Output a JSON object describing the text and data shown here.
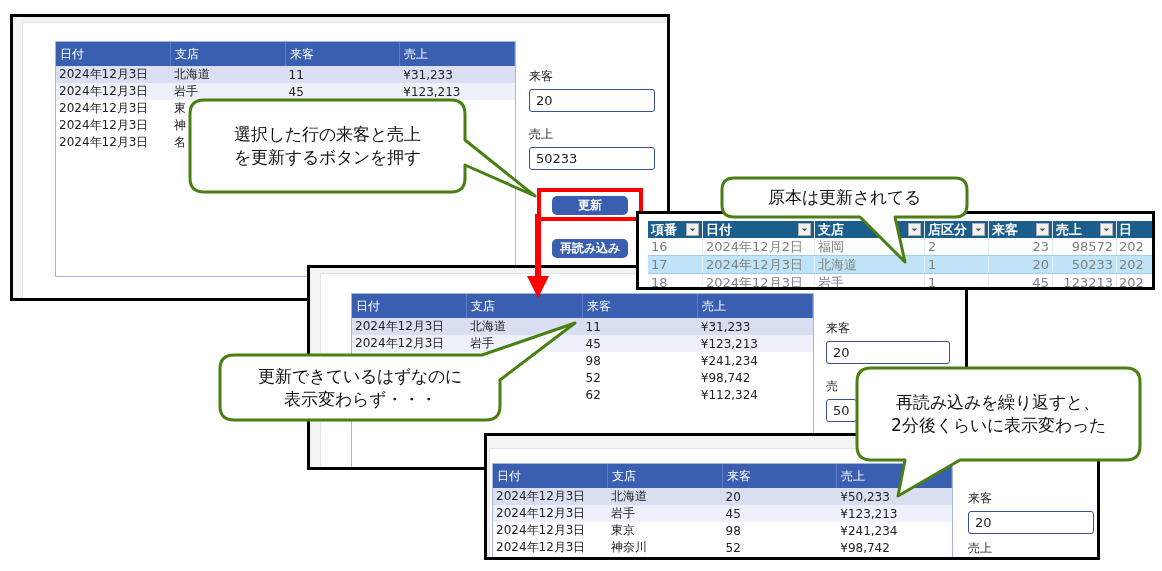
{
  "panels": [
    {
      "kind": "app",
      "columns": [
        "日付",
        "支店",
        "来客",
        "売上"
      ],
      "rows": [
        {
          "date": "2024年12月3日",
          "branch": "北海道",
          "visitors": "11",
          "sales": "¥31,233",
          "selected": true,
          "hover": false
        },
        {
          "date": "2024年12月3日",
          "branch": "岩手",
          "visitors": "45",
          "sales": "¥123,213",
          "selected": false,
          "hover": true
        },
        {
          "date": "2024年12月3日",
          "branch": "東",
          "selected": false,
          "hover": false
        },
        {
          "date": "2024年12月3日",
          "branch": "神",
          "selected": false,
          "hover": false
        },
        {
          "date": "2024年12月3日",
          "branch": "名",
          "selected": false,
          "hover": false
        }
      ],
      "fields": [
        {
          "label": "来客",
          "value": "20"
        },
        {
          "label": "売上",
          "value": "50233"
        }
      ],
      "buttons": [
        {
          "label": "更新",
          "highlighted": true
        },
        {
          "label": "再読み込み",
          "highlighted": false
        }
      ]
    },
    {
      "kind": "app",
      "columns": [
        "日付",
        "支店",
        "来客",
        "売上"
      ],
      "rows": [
        {
          "date": "2024年12月3日",
          "branch": "北海道",
          "visitors": "11",
          "sales": "¥31,233",
          "selected": true,
          "hover": false
        },
        {
          "date": "2024年12月3日",
          "branch": "岩手",
          "visitors": "45",
          "sales": "¥123,213",
          "selected": false,
          "hover": true
        },
        {
          "visitors": "98",
          "sales": "¥241,234",
          "selected": false,
          "hover": false
        },
        {
          "visitors": "52",
          "sales": "¥98,742",
          "selected": false,
          "hover": false
        },
        {
          "visitors": "62",
          "sales": "¥112,324",
          "selected": false,
          "hover": false
        }
      ],
      "fields": [
        {
          "label": "来客",
          "value": "20"
        },
        {
          "label": "売",
          "value": "50"
        }
      ]
    },
    {
      "kind": "sheet",
      "columns": [
        "項番",
        "日付",
        "支店",
        "店区分",
        "来客",
        "売上",
        "日"
      ],
      "rows": [
        {
          "cells": [
            "16",
            "2024年12月2日",
            "福岡",
            "2",
            "23",
            "98572",
            "202"
          ],
          "selected": false
        },
        {
          "cells": [
            "17",
            "2024年12月3日",
            "北海道",
            "1",
            "20",
            "50233",
            "202"
          ],
          "selected": true
        },
        {
          "cells": [
            "18",
            "2024年12月3日",
            "岩手",
            "1",
            "45",
            "123213",
            "202"
          ],
          "selected": false
        }
      ]
    },
    {
      "kind": "app",
      "columns": [
        "日付",
        "支店",
        "来客",
        "売上"
      ],
      "rows": [
        {
          "date": "2024年12月3日",
          "branch": "北海道",
          "visitors": "20",
          "sales": "¥50,233",
          "selected": true,
          "hover": false
        },
        {
          "date": "2024年12月3日",
          "branch": "岩手",
          "visitors": "45",
          "sales": "¥123,213",
          "selected": false,
          "hover": true
        },
        {
          "date": "2024年12月3日",
          "branch": "東京",
          "visitors": "98",
          "sales": "¥241,234",
          "selected": false,
          "hover": false
        },
        {
          "date": "2024年12月3日",
          "branch": "神奈川",
          "visitors": "52",
          "sales": "¥98,742",
          "selected": false,
          "hover": false
        }
      ],
      "fields": [
        {
          "label": "来客",
          "value": "20"
        },
        {
          "label": "売上"
        }
      ]
    }
  ],
  "callouts": [
    {
      "lines": [
        "選択した行の来客と売上",
        "を更新するボタンを押す"
      ]
    },
    {
      "lines": [
        "原本は更新されてる"
      ]
    },
    {
      "lines": [
        "更新できているはずなのに",
        "表示変わらず・・・"
      ]
    },
    {
      "lines": [
        "再読み込みを繰り返すと、",
        "2分後くらいに表示変わった"
      ]
    }
  ]
}
